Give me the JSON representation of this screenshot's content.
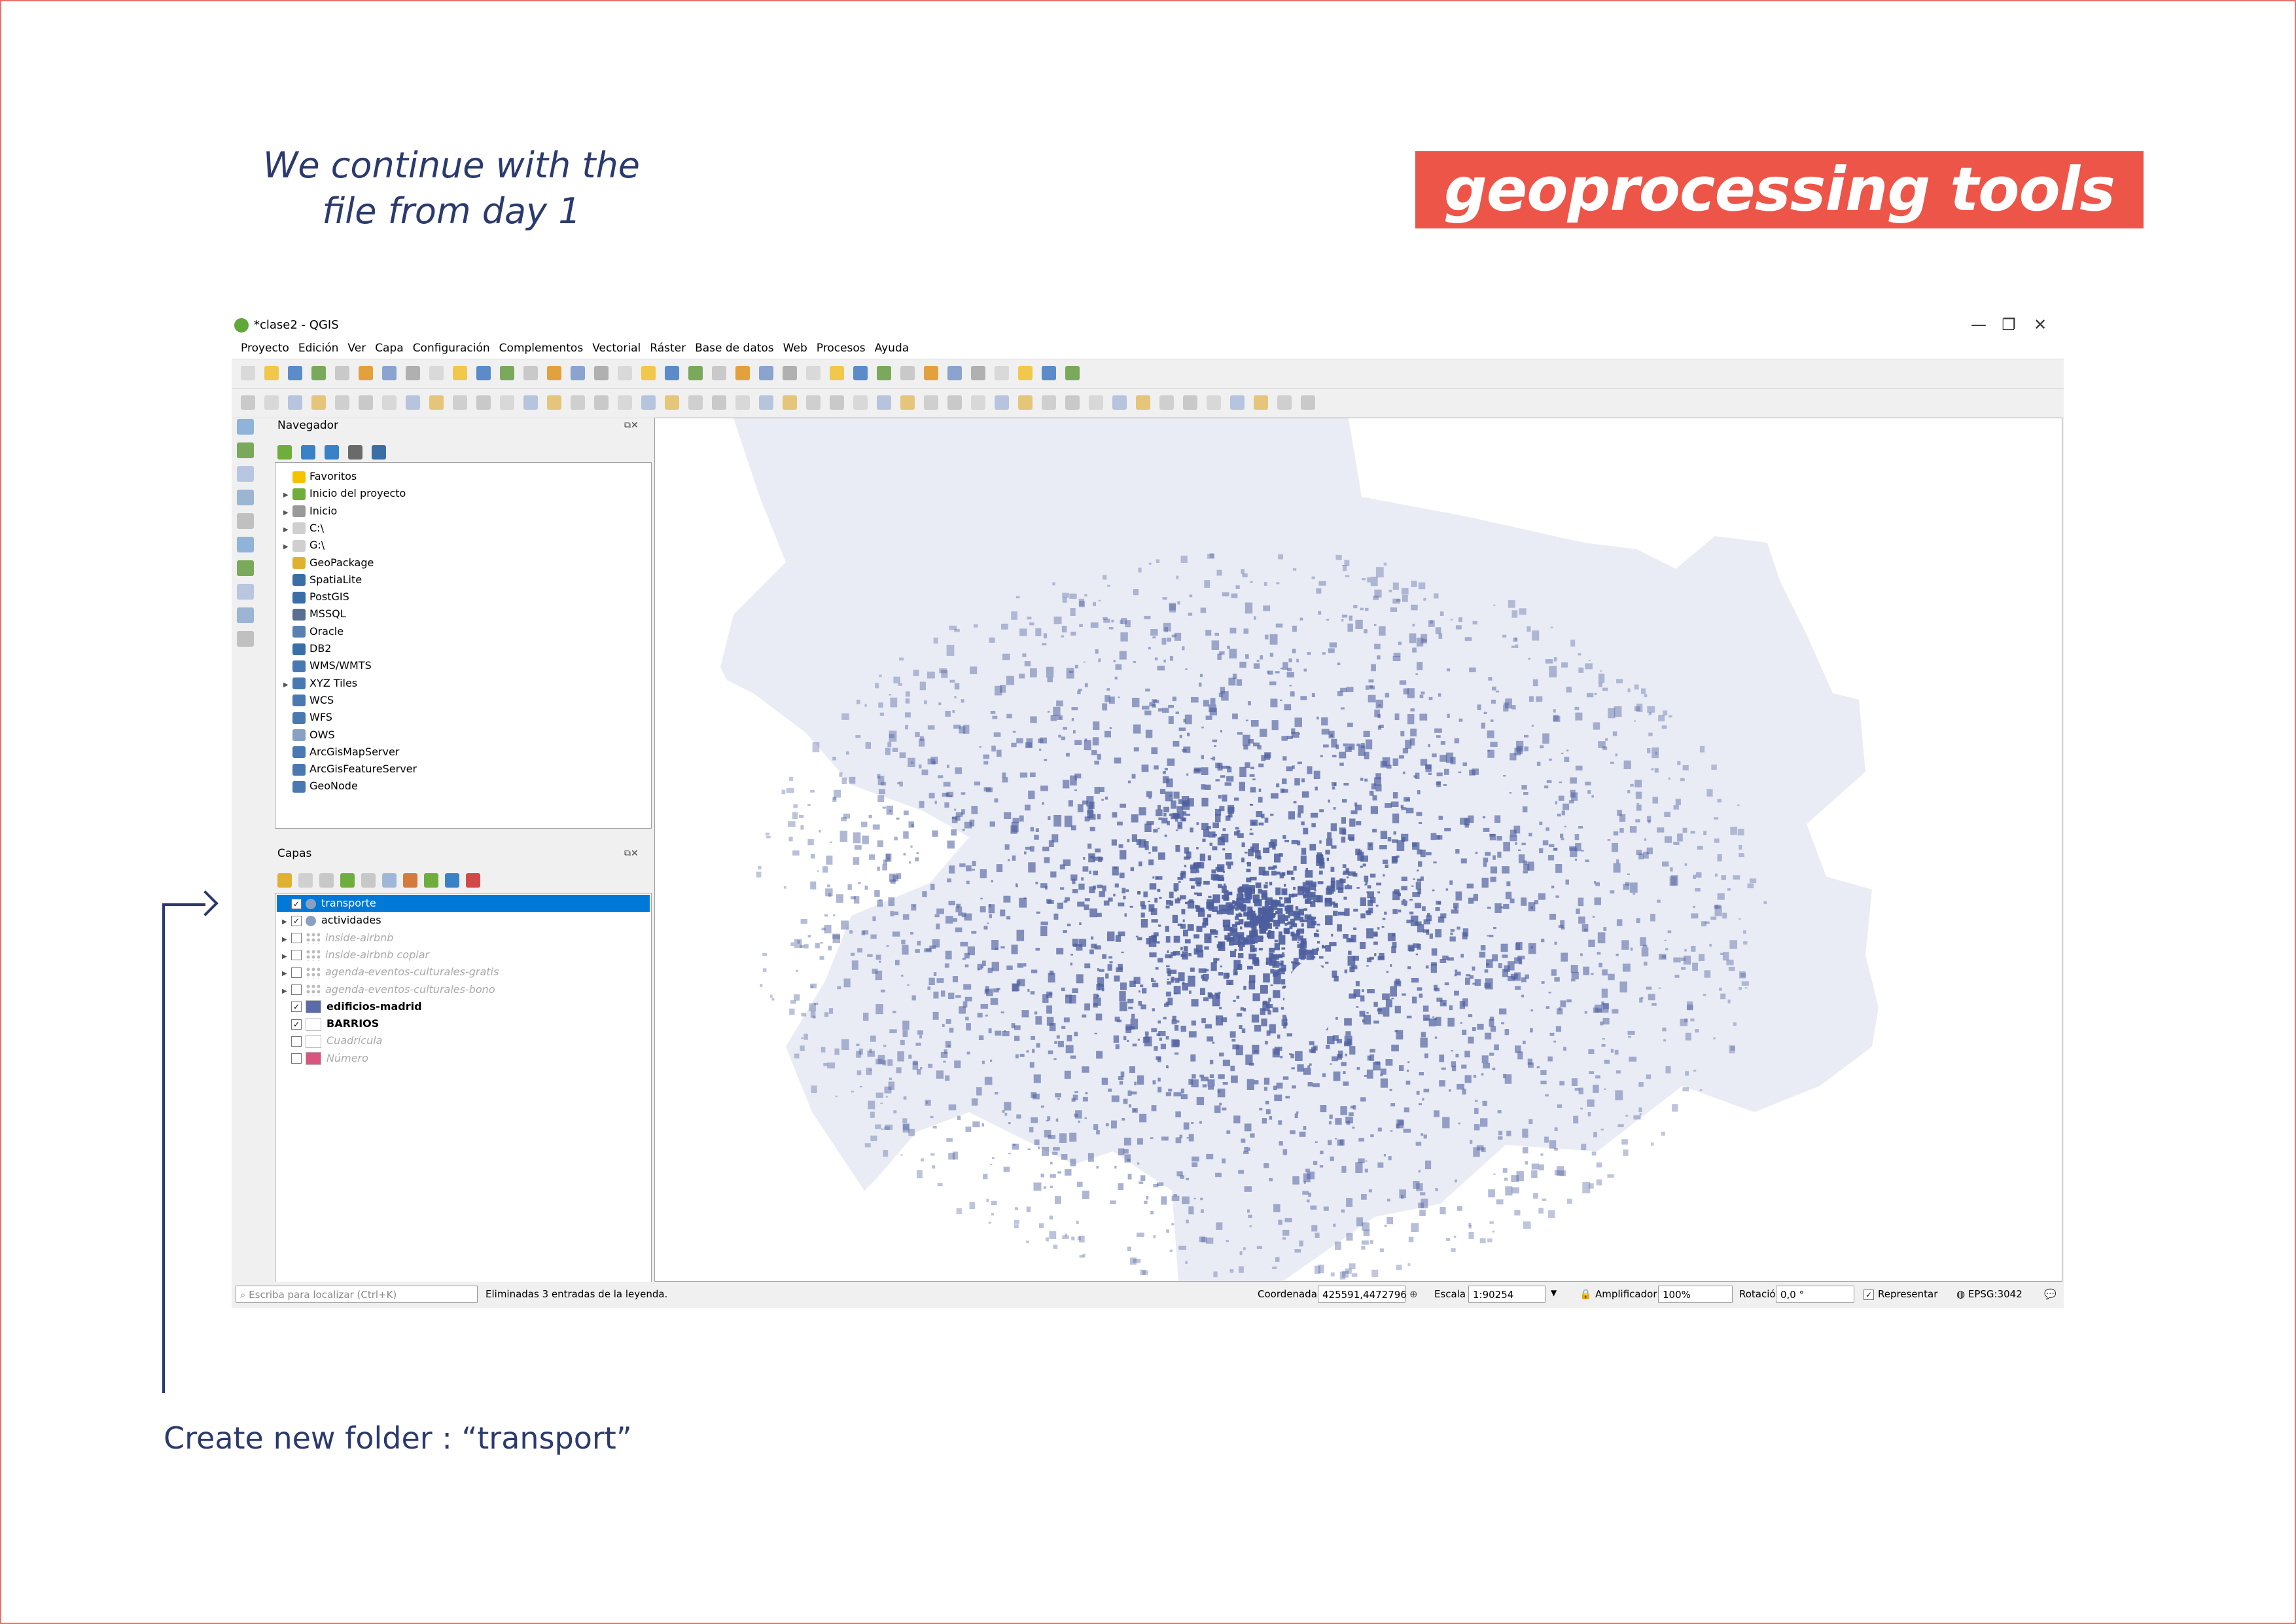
{
  "slide": {
    "intro_line1": "We continue with the",
    "intro_line2": "file from day 1",
    "banner": "geoprocessing tools",
    "caption": "Create new folder : “transport”",
    "accent_color": "#ee5549",
    "text_color": "#2b3a6e"
  },
  "window": {
    "title": "*clase2 - QGIS",
    "controls": [
      "—",
      "❐",
      "✕"
    ],
    "menu": [
      "Proyecto",
      "Edición",
      "Ver",
      "Capa",
      "Configuración",
      "Complementos",
      "Vectorial",
      "Ráster",
      "Base de datos",
      "Web",
      "Procesos",
      "Ayuda"
    ]
  },
  "navigator": {
    "title": "Navegador",
    "items": [
      {
        "label": "Favoritos",
        "icon": "star-icon",
        "expandable": false,
        "color": "#f3c300"
      },
      {
        "label": "Inicio del proyecto",
        "icon": "project-home-icon",
        "expandable": true,
        "color": "#6fae3c"
      },
      {
        "label": "Inicio",
        "icon": "home-folder-icon",
        "expandable": true,
        "color": "#9a9a9a"
      },
      {
        "label": "C:\\",
        "icon": "drive-icon",
        "expandable": true,
        "color": "#cfcfcf"
      },
      {
        "label": "G:\\",
        "icon": "drive-icon",
        "expandable": true,
        "color": "#cfcfcf"
      },
      {
        "label": "GeoPackage",
        "icon": "geopackage-icon",
        "expandable": false,
        "color": "#e0b030"
      },
      {
        "label": "SpatiaLite",
        "icon": "spatialite-icon",
        "expandable": false,
        "color": "#3a6ea5"
      },
      {
        "label": "PostGIS",
        "icon": "postgis-icon",
        "expandable": false,
        "color": "#3a6ea5"
      },
      {
        "label": "MSSQL",
        "icon": "mssql-icon",
        "expandable": false,
        "color": "#5a6e90"
      },
      {
        "label": "Oracle",
        "icon": "oracle-icon",
        "expandable": false,
        "color": "#5a7fb0"
      },
      {
        "label": "DB2",
        "icon": "db2-icon",
        "expandable": false,
        "color": "#3a6ea5"
      },
      {
        "label": "WMS/WMTS",
        "icon": "globe-icon",
        "expandable": false,
        "color": "#4a78b0"
      },
      {
        "label": "XYZ Tiles",
        "icon": "globe-icon",
        "expandable": true,
        "color": "#4a78b0"
      },
      {
        "label": "WCS",
        "icon": "globe-icon",
        "expandable": false,
        "color": "#4a78b0"
      },
      {
        "label": "WFS",
        "icon": "globe-icon",
        "expandable": false,
        "color": "#4a78b0"
      },
      {
        "label": "OWS",
        "icon": "globe-icon",
        "expandable": false,
        "color": "#8aa0c0"
      },
      {
        "label": "ArcGisMapServer",
        "icon": "arcgis-icon",
        "expandable": false,
        "color": "#4a78b0"
      },
      {
        "label": "ArcGisFeatureServer",
        "icon": "arcgis-icon",
        "expandable": false,
        "color": "#4a78b0"
      },
      {
        "label": "GeoNode",
        "icon": "geonode-icon",
        "expandable": false,
        "color": "#4a78b0"
      }
    ]
  },
  "layers": {
    "title": "Capas",
    "items": [
      {
        "label": "transporte",
        "checked": true,
        "expandable": false,
        "selected": true,
        "style": "normal",
        "swatch": "group"
      },
      {
        "label": "actividades",
        "checked": true,
        "expandable": true,
        "selected": false,
        "style": "normal",
        "swatch": "group"
      },
      {
        "label": "inside-airbnb",
        "checked": false,
        "expandable": true,
        "selected": false,
        "style": "muted",
        "swatch": "points"
      },
      {
        "label": "inside-airbnb copiar",
        "checked": false,
        "expandable": true,
        "selected": false,
        "style": "muted",
        "swatch": "points"
      },
      {
        "label": "agenda-eventos-culturales-gratis",
        "checked": false,
        "expandable": true,
        "selected": false,
        "style": "muted",
        "swatch": "points"
      },
      {
        "label": "agenda-eventos-culturales-bono",
        "checked": false,
        "expandable": true,
        "selected": false,
        "style": "muted",
        "swatch": "points"
      },
      {
        "label": "edificios-madrid",
        "checked": true,
        "expandable": false,
        "selected": false,
        "style": "bold",
        "swatch": "#5b6aa8"
      },
      {
        "label": "BARRIOS",
        "checked": true,
        "expandable": false,
        "selected": false,
        "style": "bold",
        "swatch": "#ffffff"
      },
      {
        "label": "Cuadrícula",
        "checked": false,
        "expandable": false,
        "selected": false,
        "style": "muted",
        "swatch": "#ffffff"
      },
      {
        "label": "Número",
        "checked": false,
        "expandable": false,
        "selected": false,
        "style": "muted",
        "swatch": "#d9547e"
      }
    ]
  },
  "statusbar": {
    "locator_placeholder": "Escriba para localizar (Ctrl+K)",
    "message": "Eliminadas 3 entradas de la leyenda.",
    "coord_label": "Coordenada",
    "coord_value": "425591,4472796",
    "scale_label": "Escala",
    "scale_value": "1:90254",
    "magnifier_label": "Amplificador",
    "magnifier_value": "100%",
    "rotation_label": "Rotación",
    "rotation_value": "0,0 °",
    "render_label": "Representar",
    "crs": "EPSG:3042"
  },
  "map": {
    "background_color": "#e9ecf4",
    "building_color": "#4d5e9e"
  }
}
